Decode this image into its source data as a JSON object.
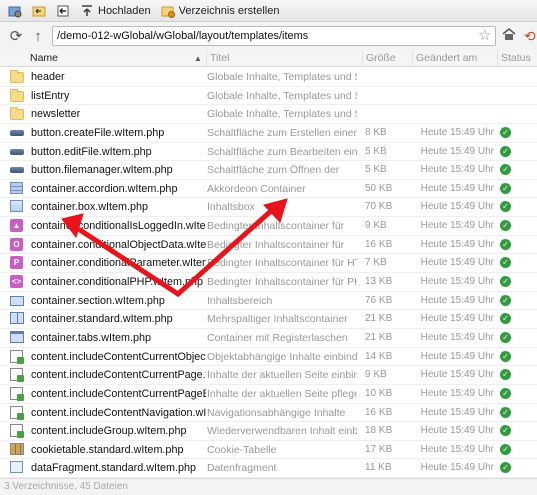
{
  "toolbar": {
    "upload_label": "Hochladen",
    "new_folder_label": "Verzeichnis erstellen"
  },
  "address": {
    "path": "/demo-012-wGlobal/wGlobal/layout/templates/items"
  },
  "columns": {
    "name": "Name",
    "title": "Titel",
    "size": "Größe",
    "date": "Geändert am",
    "status": "Status"
  },
  "rows": [
    {
      "icon": "folder",
      "name": "header",
      "title": "Globale Inhalte, Templates und Skripte",
      "size": "",
      "date": "",
      "status": false
    },
    {
      "icon": "folder",
      "name": "listEntry",
      "title": "Globale Inhalte, Templates und Skripte",
      "size": "",
      "date": "",
      "status": false
    },
    {
      "icon": "folder",
      "name": "newsletter",
      "title": "Globale Inhalte, Templates und Skripte",
      "size": "",
      "date": "",
      "status": false
    },
    {
      "icon": "btn",
      "name": "button.createFile.wItem.php",
      "title": "Schaltfläche zum Erstellen einer Datei",
      "size": "8 KB",
      "date": "Heute 15:49 Uhr",
      "status": true
    },
    {
      "icon": "btn",
      "name": "button.editFile.wItem.php",
      "title": "Schaltfläche zum Bearbeiten einer",
      "size": "5 KB",
      "date": "Heute 15:49 Uhr",
      "status": true
    },
    {
      "icon": "btn",
      "name": "button.filemanager.wItem.php",
      "title": "Schaltfläche zum Öffnen der",
      "size": "5 KB",
      "date": "Heute 15:49 Uhr",
      "status": true
    },
    {
      "icon": "acc",
      "name": "container.accordion.wItem.php",
      "title": "Akkordeon Container",
      "size": "50 KB",
      "date": "Heute 15:49 Uhr",
      "status": true
    },
    {
      "icon": "box",
      "name": "container.box.wItem.php",
      "title": "Inhaltsbox",
      "size": "70 KB",
      "date": "Heute 15:49 Uhr",
      "status": true
    },
    {
      "icon": "pink",
      "glyph": "▲",
      "name": "container.conditionalIsLoggedIn.wItem.php",
      "title": "Bedingter Inhaltscontainer für",
      "size": "9 KB",
      "date": "Heute 15:49 Uhr",
      "status": true
    },
    {
      "icon": "pink",
      "glyph": "O",
      "name": "container.conditionalObjectData.wItem.php",
      "title": "Bedingter Inhaltscontainer für",
      "size": "16 KB",
      "date": "Heute 15:49 Uhr",
      "status": true
    },
    {
      "icon": "pink",
      "glyph": "P",
      "name": "container.conditionalParameter.wItem.php",
      "title": "Bedingter Inhaltscontainer für HTTP-",
      "size": "7 KB",
      "date": "Heute 15:49 Uhr",
      "status": true
    },
    {
      "icon": "pink",
      "glyph": "<>",
      "name": "container.conditionalPHP.wItem.php",
      "title": "Bedingter Inhaltscontainer für PHP",
      "size": "13 KB",
      "date": "Heute 15:49 Uhr",
      "status": true
    },
    {
      "icon": "sec",
      "name": "container.section.wItem.php",
      "title": "Inhaltsbereich",
      "size": "76 KB",
      "date": "Heute 15:49 Uhr",
      "status": true
    },
    {
      "icon": "std",
      "name": "container.standard.wItem.php",
      "title": "Mehrspaltiger Inhaltscontainer",
      "size": "21 KB",
      "date": "Heute 15:49 Uhr",
      "status": true
    },
    {
      "icon": "tabs",
      "name": "container.tabs.wItem.php",
      "title": "Container mit Registerlaschen",
      "size": "21 KB",
      "date": "Heute 15:49 Uhr",
      "status": true
    },
    {
      "icon": "inc",
      "name": "content.includeContentCurrentObject.wItem.p",
      "title": "Objektabhängige Inhalte einbinden",
      "size": "14 KB",
      "date": "Heute 15:49 Uhr",
      "status": true
    },
    {
      "icon": "inc",
      "name": "content.includeContentCurrentPage.wItem.ph",
      "title": "Inhalte der aktuellen Seite einbinden",
      "size": "9 KB",
      "date": "Heute 15:49 Uhr",
      "status": true
    },
    {
      "icon": "inc",
      "name": "content.includeContentCurrentPageEdit.wIten",
      "title": "Inhalte der aktuellen Seite pflegen",
      "size": "10 KB",
      "date": "Heute 15:49 Uhr",
      "status": true
    },
    {
      "icon": "inc",
      "name": "content.includeContentNavigation.wItem.php",
      "title": "Navigationsabhängige Inhalte",
      "size": "16 KB",
      "date": "Heute 15:49 Uhr",
      "status": true
    },
    {
      "icon": "inc",
      "name": "content.includeGroup.wItem.php",
      "title": "Wiederverwendbaren Inhalt einbinden",
      "size": "18 KB",
      "date": "Heute 15:49 Uhr",
      "status": true
    },
    {
      "icon": "cookie",
      "name": "cookietable.standard.wItem.php",
      "title": "Cookie-Tabelle",
      "size": "17 KB",
      "date": "Heute 15:49 Uhr",
      "status": true
    },
    {
      "icon": "frag",
      "name": "dataFragment.standard.wItem.php",
      "title": "Datenfragment",
      "size": "11 KB",
      "date": "Heute 15:49 Uhr",
      "status": true
    }
  ],
  "statusbar": {
    "summary": "3 Verzeichnisse, 45 Dateien"
  },
  "colors": {
    "annotation_arrow": "#e8141b",
    "status_ok": "#2f9a3e"
  }
}
